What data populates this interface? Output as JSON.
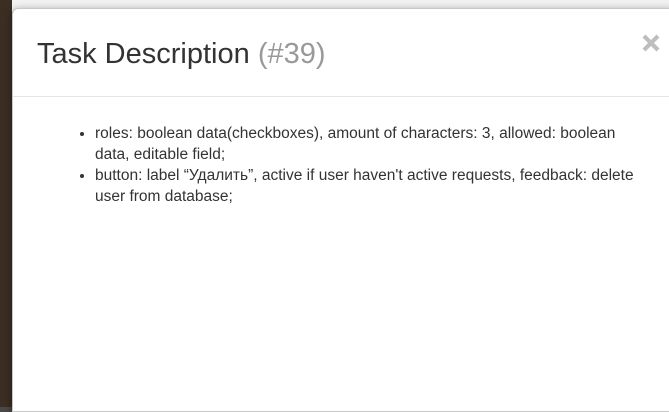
{
  "modal": {
    "title": "Task Description",
    "task_id": "(#39)",
    "close_icon": "close-icon"
  },
  "description": {
    "items": [
      {
        "text": "roles: boolean data(checkboxes), amount of characters: 3, allowed: boolean data, editable field;"
      },
      {
        "text": "button: label “Удалить”, active if user haven't active requests, feedback: delete user from database;"
      }
    ]
  },
  "colors": {
    "title": "#333333",
    "task_id": "#999999",
    "close_icon": "#000000",
    "divider": "#e5e5e5"
  }
}
